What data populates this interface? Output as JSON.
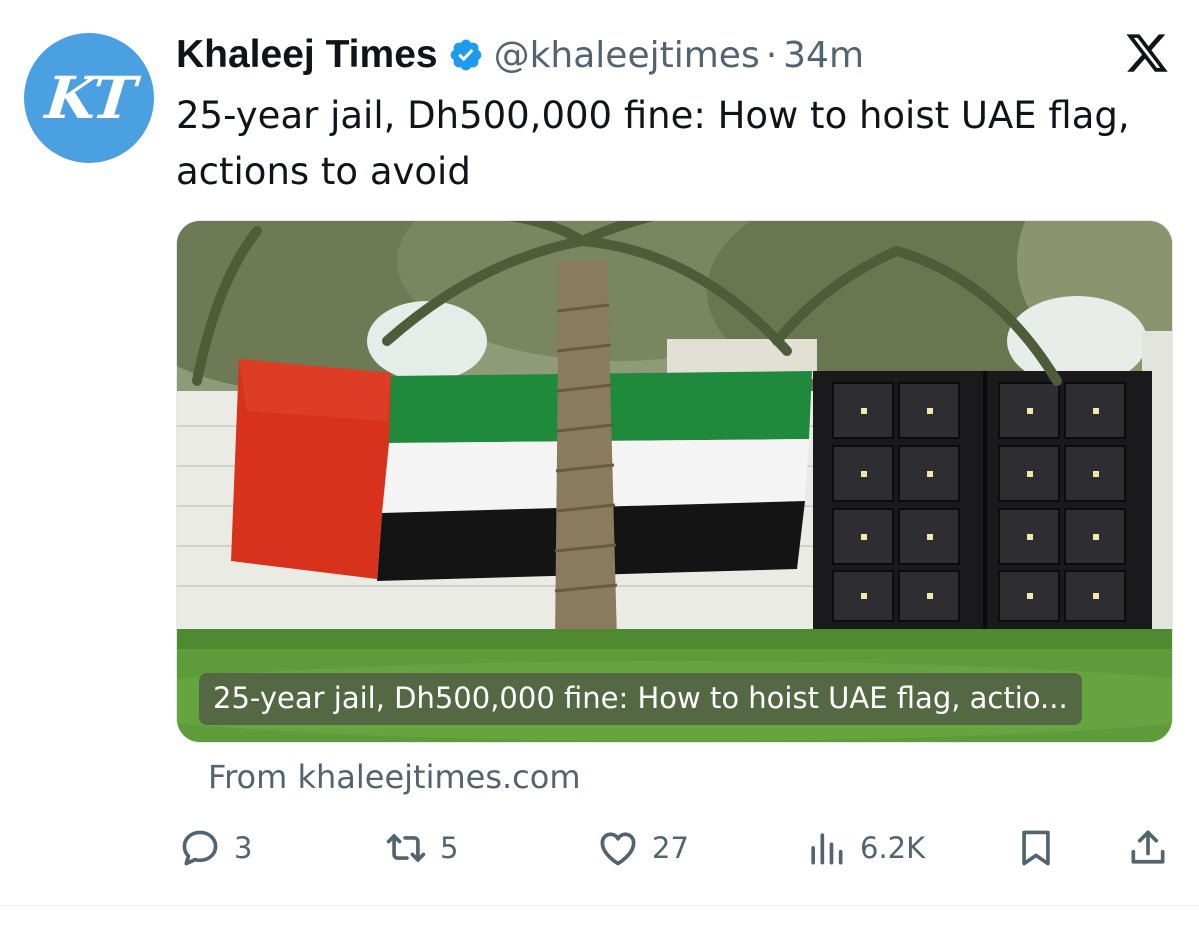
{
  "author": {
    "display_name": "Khaleej Times",
    "avatar_monogram": "KT",
    "handle": "@khaleejtimes",
    "separator": "·",
    "time": "34m",
    "verified": true,
    "avatar_color": "#4aa0e0",
    "verified_color": "#1d9bf0"
  },
  "platform_icon": "x-logo-icon",
  "tweet": {
    "text": "25-year jail, Dh500,000 fine: How to hoist UAE flag, actions to avoid"
  },
  "link_card": {
    "image": "uae-flag-on-wall-photo",
    "caption": "25-year jail, Dh500,000 fine: How to hoist UAE flag, actio...",
    "source": "From khaleejtimes.com"
  },
  "actions": {
    "reply": {
      "icon": "reply-icon",
      "count": "3"
    },
    "repost": {
      "icon": "repost-icon",
      "count": "5"
    },
    "like": {
      "icon": "heart-icon",
      "count": "27"
    },
    "views": {
      "icon": "views-icon",
      "count": "6.2K"
    },
    "bookmark": {
      "icon": "bookmark-icon"
    },
    "share": {
      "icon": "share-icon"
    }
  },
  "colors": {
    "text_primary": "#0f1419",
    "text_secondary": "#536471",
    "flag_red": "#d8321c",
    "flag_green": "#1f8a3c",
    "flag_white": "#f4f4f4",
    "flag_black": "#141414"
  }
}
